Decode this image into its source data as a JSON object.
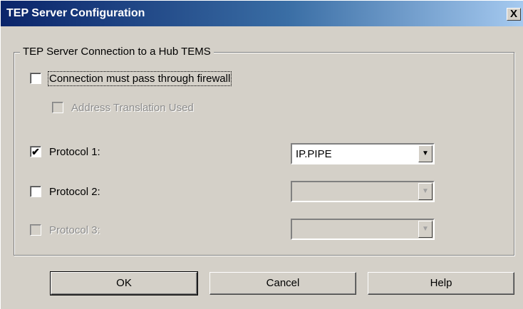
{
  "window": {
    "title": "TEP Server Configuration",
    "close_glyph": "X"
  },
  "group": {
    "legend": "TEP Server Connection to a Hub TEMS"
  },
  "options": {
    "firewall": {
      "label": "Connection must pass through firewall",
      "checked": false
    },
    "address_translation": {
      "label": "Address Translation Used",
      "checked": false,
      "enabled": false
    }
  },
  "protocols": [
    {
      "label": "Protocol 1:",
      "checked": true,
      "enabled": true,
      "value": "IP.PIPE"
    },
    {
      "label": "Protocol 2:",
      "checked": false,
      "enabled": true,
      "value": ""
    },
    {
      "label": "Protocol 3:",
      "checked": false,
      "enabled": false,
      "value": ""
    }
  ],
  "checkmark": "✔",
  "dropdown_glyph": "▼",
  "buttons": {
    "ok": "OK",
    "cancel": "Cancel",
    "help": "Help"
  }
}
